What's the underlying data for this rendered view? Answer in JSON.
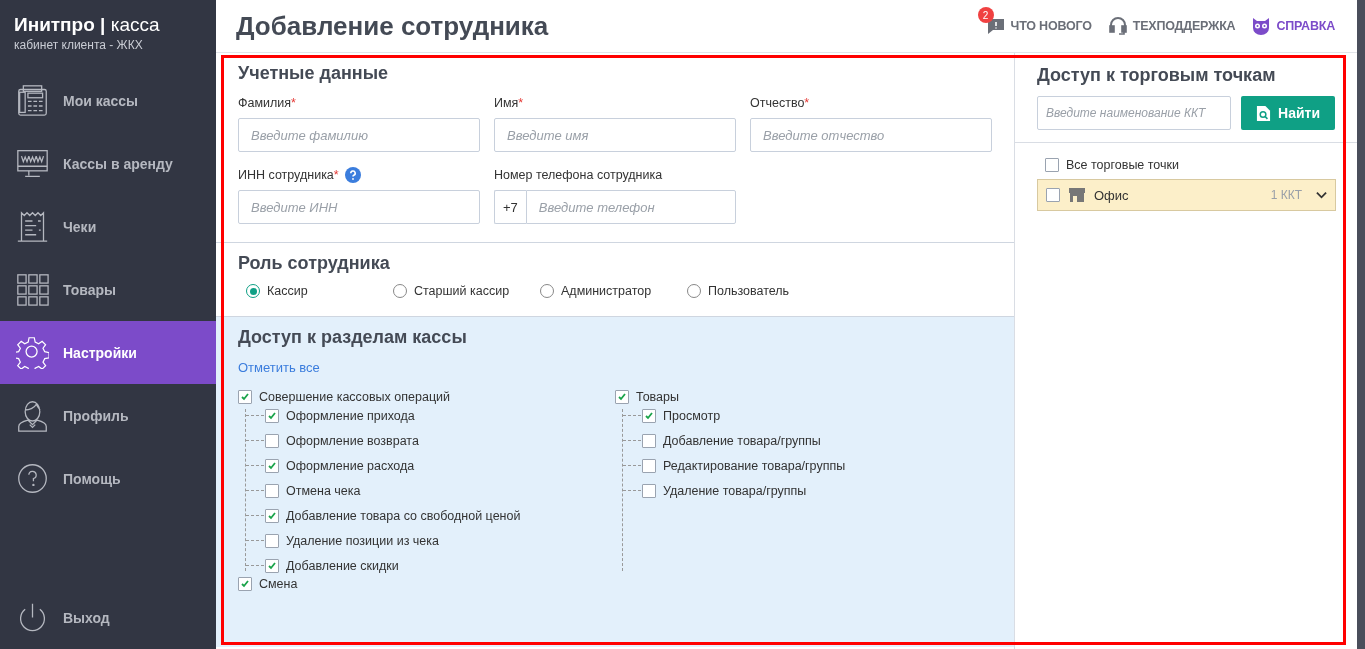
{
  "sidebar": {
    "logo": "**Инитпро |** касса",
    "subtitle": "кабинет клиента - ЖКХ",
    "items": [
      {
        "kind": "phone",
        "label": "Мои кассы",
        "selected": false
      },
      {
        "kind": "monitor",
        "label": "Кассы в аренду",
        "selected": false
      },
      {
        "kind": "receipt",
        "label": "Чеки",
        "selected": false
      },
      {
        "kind": "grid",
        "label": "Товары",
        "selected": false
      },
      {
        "kind": "gear",
        "label": "Настройки",
        "selected": true
      },
      {
        "kind": "person",
        "label": "Профиль",
        "selected": false
      },
      {
        "kind": "help",
        "label": "Помощь",
        "selected": false
      }
    ],
    "logout": "Выход"
  },
  "header": {
    "title": "Добавление сотрудника",
    "links": [
      {
        "kind": "news",
        "label": "ЧТО НОВОГО",
        "badge": "2",
        "highlighted": false
      },
      {
        "kind": "support",
        "label": "ТЕХПОДДЕРЖКА",
        "highlighted": false
      },
      {
        "kind": "owl",
        "label": "СПРАВКА",
        "highlighted": true
      }
    ]
  },
  "credentials": {
    "title": "Учетные данные",
    "fields": [
      {
        "label": "Фамилия",
        "required_mark": "*",
        "placeholder": "Введите фамилию"
      },
      {
        "label": "Имя",
        "required_mark": "*",
        "placeholder": "Введите имя"
      },
      {
        "label": "Отчество",
        "required_mark": "*",
        "placeholder": "Введите отчество"
      },
      {
        "label": "ИНН сотрудника",
        "required_mark": "*",
        "help": true,
        "placeholder": "Введите ИНН"
      },
      {
        "label": "Номер телефона сотрудника",
        "prefix": "+7",
        "placeholder": "Введите телефон"
      }
    ]
  },
  "role": {
    "title": "Роль сотрудника",
    "options": [
      {
        "label": "Кассир",
        "selected": true
      },
      {
        "label": "Старший кассир",
        "selected": false
      },
      {
        "label": "Администратор",
        "selected": false
      },
      {
        "label": "Пользователь",
        "selected": false
      }
    ]
  },
  "access": {
    "title": "Доступ к разделам кассы",
    "select_all": "Отметить все",
    "columns": [
      [
        {
          "label": "Совершение кассовых операций",
          "checked": true,
          "children": [
            {
              "label": "Оформление прихода",
              "checked": true
            },
            {
              "label": "Оформление возврата",
              "checked": false
            },
            {
              "label": "Оформление расхода",
              "checked": true
            },
            {
              "label": "Отмена чека",
              "checked": false
            },
            {
              "label": "Добавление товара со свободной ценой",
              "checked": true
            },
            {
              "label": "Удаление позиции из чека",
              "checked": false
            },
            {
              "label": "Добавление скидки",
              "checked": true
            }
          ]
        },
        {
          "label": "Смена",
          "checked": true
        }
      ],
      [
        {
          "label": "Товары",
          "checked": true,
          "children": [
            {
              "label": "Просмотр",
              "checked": true
            },
            {
              "label": "Добавление товара/группы",
              "checked": false
            },
            {
              "label": "Редактирование товара/группы",
              "checked": false
            },
            {
              "label": "Удаление товара/группы",
              "checked": false
            }
          ]
        }
      ]
    ]
  },
  "points": {
    "title": "Доступ к торговым точкам",
    "search_placeholder": "Введите наименование ККТ",
    "search_button": "Найти",
    "all": {
      "label": "Все торговые точки",
      "checked": false
    },
    "items": [
      {
        "label": "Офис",
        "count": "1 ККТ",
        "checked": false
      }
    ]
  }
}
